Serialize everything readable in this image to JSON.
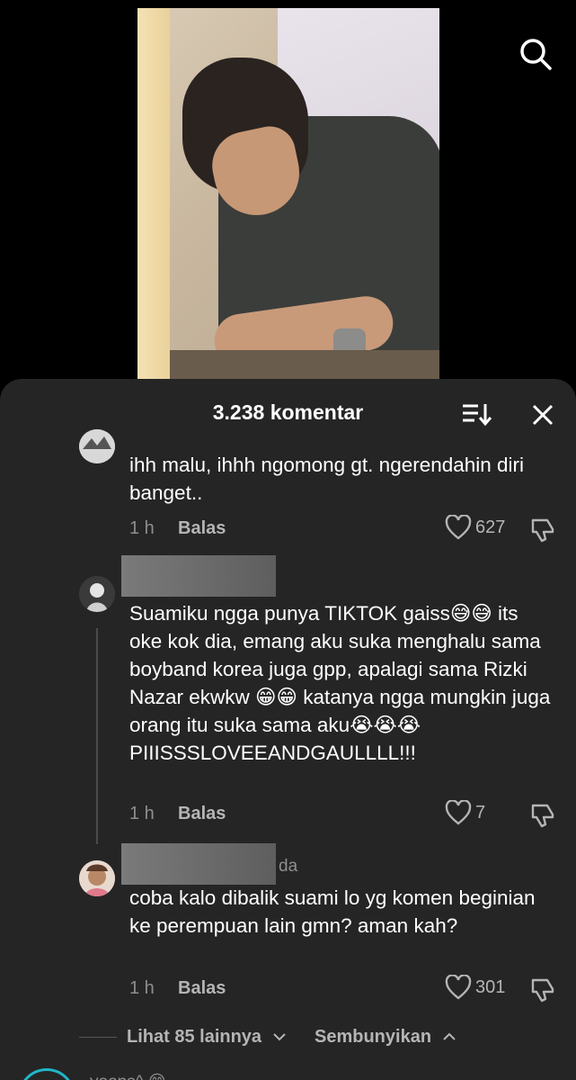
{
  "sheet": {
    "title": "3.238 komentar"
  },
  "comments": [
    {
      "text": "ihh malu, ihhh ngomong gt. ngerendahin diri banget..",
      "time": "1 h",
      "reply_label": "Balas",
      "likes": "627"
    },
    {
      "text": "Suamiku ngga punya TIKTOK gaiss😅😅 its oke kok dia, emang aku suka menghalu sama boyband korea juga gpp, apalagi sama Rizki Nazar ekwkw 😁😁 katanya ngga mungkin juga orang itu suka sama aku😭😭😭 PIIISSSLOVEEANDGAULLLL!!!",
      "time": "1 h",
      "reply_label": "Balas",
      "likes": "7"
    },
    {
      "username_suffix": "da",
      "text": "coba kalo dibalik suami lo yg komen beginian ke perempuan lain gmn? aman kah?",
      "time": "1 h",
      "reply_label": "Balas",
      "likes": "301"
    }
  ],
  "thread_controls": {
    "view_more": "Lihat 85 lainnya",
    "hide": "Sembunyikan"
  },
  "next_comment": {
    "username_partial": "yoops^ 😊"
  },
  "icons": {
    "search": "search-icon",
    "sort": "sort-icon",
    "close": "close-icon",
    "like": "heart-icon",
    "dislike": "dislike-icon"
  },
  "colors": {
    "sheet_bg": "#252525",
    "secondary_text": "#8e8e8e",
    "accent_ring": "#1fb6c8"
  }
}
